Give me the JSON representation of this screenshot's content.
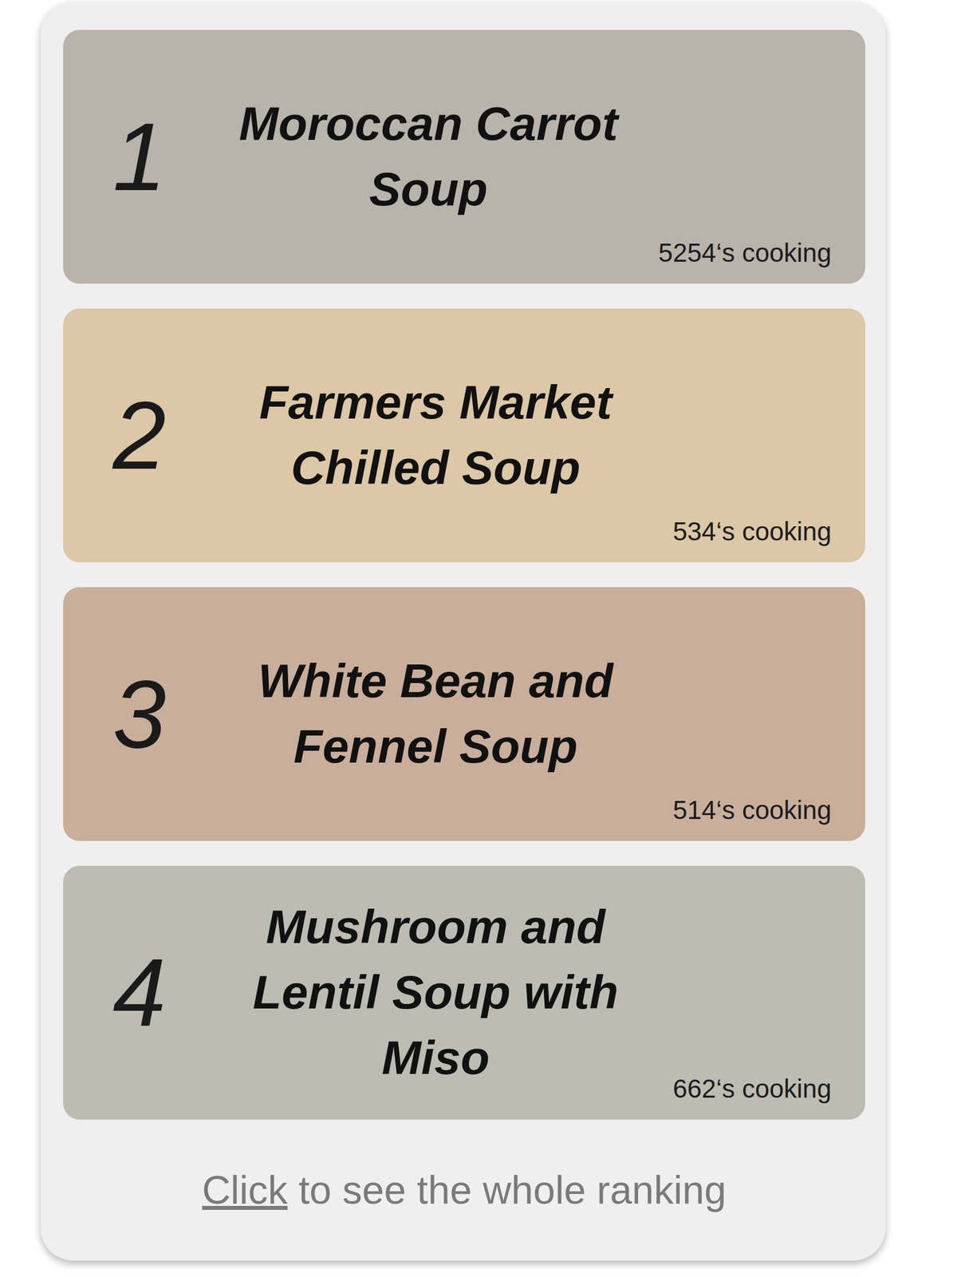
{
  "ranking": [
    {
      "rank": "1",
      "title": "Moroccan Carrot Soup",
      "count": "5254‘s cooking"
    },
    {
      "rank": "2",
      "title": "Farmers Market Chilled Soup",
      "count": "534‘s cooking"
    },
    {
      "rank": "3",
      "title": "White Bean and Fennel Soup",
      "count": "514‘s cooking"
    },
    {
      "rank": "4",
      "title": "Mushroom and Lentil Soup with Miso",
      "count": "662‘s cooking"
    }
  ],
  "footer": {
    "link": "Click",
    "text": " to see the whole ranking"
  }
}
